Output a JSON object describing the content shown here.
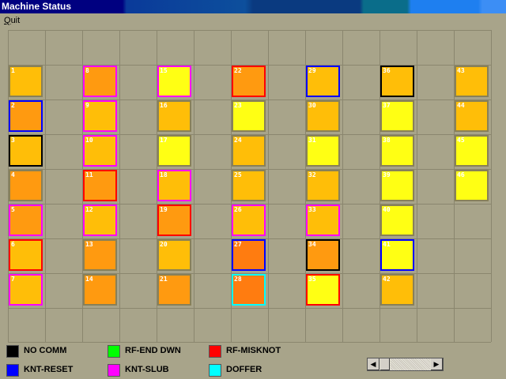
{
  "window": {
    "title": "Machine Status"
  },
  "menu": {
    "quit_label": "Quit",
    "quit_accel": "Q",
    "quit_rest": "uit"
  },
  "colors": {
    "fill": {
      "orange": "#ff9a10",
      "amber": "#ffbe08",
      "yellow": "#ffff14",
      "deep": "#ff7c10"
    },
    "status": {
      "none": "#888058",
      "NO COMM": "#000000",
      "KNT-RESET": "#0000ff",
      "RF-END DWN": "#00ff00",
      "KNT-SLUB": "#ff00ff",
      "RF-MISKNOT": "#ff0000",
      "DOFFER": "#00ffff"
    }
  },
  "machines": [
    {
      "id": "1",
      "fill": "amber",
      "status": "none"
    },
    {
      "id": "2",
      "fill": "orange",
      "status": "KNT-RESET"
    },
    {
      "id": "3",
      "fill": "amber",
      "status": "NO COMM"
    },
    {
      "id": "4",
      "fill": "orange",
      "status": "none"
    },
    {
      "id": "5",
      "fill": "orange",
      "status": "KNT-SLUB"
    },
    {
      "id": "6",
      "fill": "amber",
      "status": "RF-MISKNOT"
    },
    {
      "id": "7",
      "fill": "amber",
      "status": "KNT-SLUB"
    },
    {
      "id": "8",
      "fill": "orange",
      "status": "KNT-SLUB"
    },
    {
      "id": "9",
      "fill": "amber",
      "status": "KNT-SLUB"
    },
    {
      "id": "10",
      "fill": "amber",
      "status": "KNT-SLUB"
    },
    {
      "id": "11",
      "fill": "orange",
      "status": "RF-MISKNOT"
    },
    {
      "id": "12",
      "fill": "amber",
      "status": "KNT-SLUB"
    },
    {
      "id": "13",
      "fill": "orange",
      "status": "none"
    },
    {
      "id": "14",
      "fill": "orange",
      "status": "none"
    },
    {
      "id": "15",
      "fill": "yellow",
      "status": "KNT-SLUB"
    },
    {
      "id": "16",
      "fill": "amber",
      "status": "none"
    },
    {
      "id": "17",
      "fill": "yellow",
      "status": "none"
    },
    {
      "id": "18",
      "fill": "amber",
      "status": "KNT-SLUB"
    },
    {
      "id": "19",
      "fill": "orange",
      "status": "RF-MISKNOT"
    },
    {
      "id": "20",
      "fill": "amber",
      "status": "none"
    },
    {
      "id": "21",
      "fill": "orange",
      "status": "none"
    },
    {
      "id": "22",
      "fill": "orange",
      "status": "RF-MISKNOT"
    },
    {
      "id": "23",
      "fill": "yellow",
      "status": "none"
    },
    {
      "id": "24",
      "fill": "amber",
      "status": "none"
    },
    {
      "id": "25",
      "fill": "amber",
      "status": "none"
    },
    {
      "id": "26",
      "fill": "amber",
      "status": "KNT-SLUB"
    },
    {
      "id": "27",
      "fill": "deep",
      "status": "KNT-RESET"
    },
    {
      "id": "28",
      "fill": "deep",
      "status": "DOFFER"
    },
    {
      "id": "29",
      "fill": "amber",
      "status": "KNT-RESET"
    },
    {
      "id": "30",
      "fill": "amber",
      "status": "none"
    },
    {
      "id": "31",
      "fill": "yellow",
      "status": "none"
    },
    {
      "id": "32",
      "fill": "amber",
      "status": "none"
    },
    {
      "id": "33",
      "fill": "amber",
      "status": "KNT-SLUB"
    },
    {
      "id": "34",
      "fill": "orange",
      "status": "NO COMM"
    },
    {
      "id": "35",
      "fill": "yellow",
      "status": "RF-MISKNOT"
    },
    {
      "id": "36",
      "fill": "amber",
      "status": "NO COMM"
    },
    {
      "id": "37",
      "fill": "yellow",
      "status": "none"
    },
    {
      "id": "38",
      "fill": "yellow",
      "status": "none"
    },
    {
      "id": "39",
      "fill": "yellow",
      "status": "none"
    },
    {
      "id": "40",
      "fill": "yellow",
      "status": "none"
    },
    {
      "id": "41",
      "fill": "yellow",
      "status": "KNT-RESET"
    },
    {
      "id": "42",
      "fill": "amber",
      "status": "none"
    },
    {
      "id": "43",
      "fill": "amber",
      "status": "none"
    },
    {
      "id": "44",
      "fill": "amber",
      "status": "none"
    },
    {
      "id": "45",
      "fill": "yellow",
      "status": "none"
    },
    {
      "id": "46",
      "fill": "yellow",
      "status": "none"
    }
  ],
  "legend": [
    {
      "label": "NO COMM",
      "color": "#000000"
    },
    {
      "label": "RF-END DWN",
      "color": "#00ff00"
    },
    {
      "label": "RF-MISKNOT",
      "color": "#ff0000"
    },
    {
      "label": "KNT-RESET",
      "color": "#0000ff"
    },
    {
      "label": "KNT-SLUB",
      "color": "#ff00ff"
    },
    {
      "label": "DOFFER",
      "color": "#00ffff"
    }
  ]
}
